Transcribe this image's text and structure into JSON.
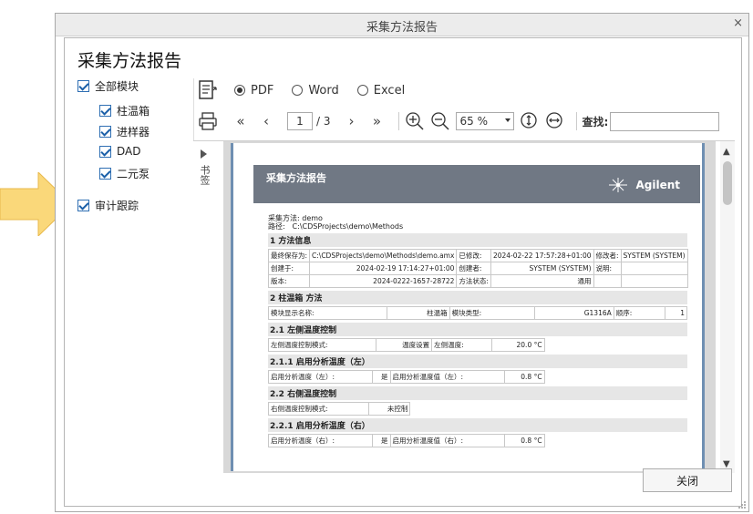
{
  "dialog": {
    "title": "采集方法报告",
    "close_glyph": "×",
    "heading": "采集方法报告",
    "close_button": "关闭"
  },
  "tree": {
    "all_modules": "全部模块",
    "modules": [
      "柱温箱",
      "进样器",
      "DAD",
      "二元泵"
    ],
    "audit": "审计跟踪"
  },
  "formats": {
    "options": [
      "PDF",
      "Word",
      "Excel"
    ],
    "selected": "PDF"
  },
  "nav": {
    "first": "«",
    "prev": "‹",
    "page": "1",
    "total": "/ 3",
    "next": "›",
    "last": "»",
    "zoom": "65 %",
    "find_label": "查找:"
  },
  "viewer": {
    "bookmark_label": "书签"
  },
  "report": {
    "title": "采集方法报告",
    "brand": "Agilent",
    "method_label": "采集方法:",
    "method_value": "demo",
    "path_label": "路径:",
    "path_value": "C:\\CDSProjects\\demo\\Methods",
    "sec1": "1 方法信息",
    "info_rows": [
      [
        "最终保存为:",
        "C:\\CDSProjects\\demo\\Methods\\demo.amx",
        "已修改:",
        "2024-02-22 17:57:28+01:00",
        "修改者:",
        "SYSTEM (SYSTEM)"
      ],
      [
        "创建于:",
        "2024-02-19 17:14:27+01:00",
        "创建者:",
        "SYSTEM (SYSTEM)",
        "说明:",
        ""
      ],
      [
        "版本:",
        "2024-0222-1657-28722",
        "方法状态:",
        "通用",
        "",
        ""
      ]
    ],
    "sec2": "2 柱温箱 方法",
    "row2": [
      "模块显示名称:",
      "柱温箱",
      "模块类型:",
      "G1316A",
      "顺序:",
      "1"
    ],
    "sec21": "2.1 左侧温度控制",
    "row21": [
      "左侧温度控制模式:",
      "温度设置",
      "左侧温度:",
      "20.0 °C"
    ],
    "sec211": "2.1.1 启用分析温度（左）",
    "row211": [
      "启用分析温度（左）:",
      "是",
      "启用分析温度值（左）:",
      "0.8 °C"
    ],
    "sec22": "2.2 右侧温度控制",
    "row22": [
      "右侧温度控制模式:",
      "未控制"
    ],
    "sec221": "2.2.1 启用分析温度（右）",
    "row221": [
      "启用分析温度（右）:",
      "是",
      "启用分析温度值（右）:",
      "0.8 °C"
    ]
  },
  "colors": {
    "callout": "#f9c74f",
    "report_header": "#707884",
    "page_border": "#6f8fb2"
  }
}
